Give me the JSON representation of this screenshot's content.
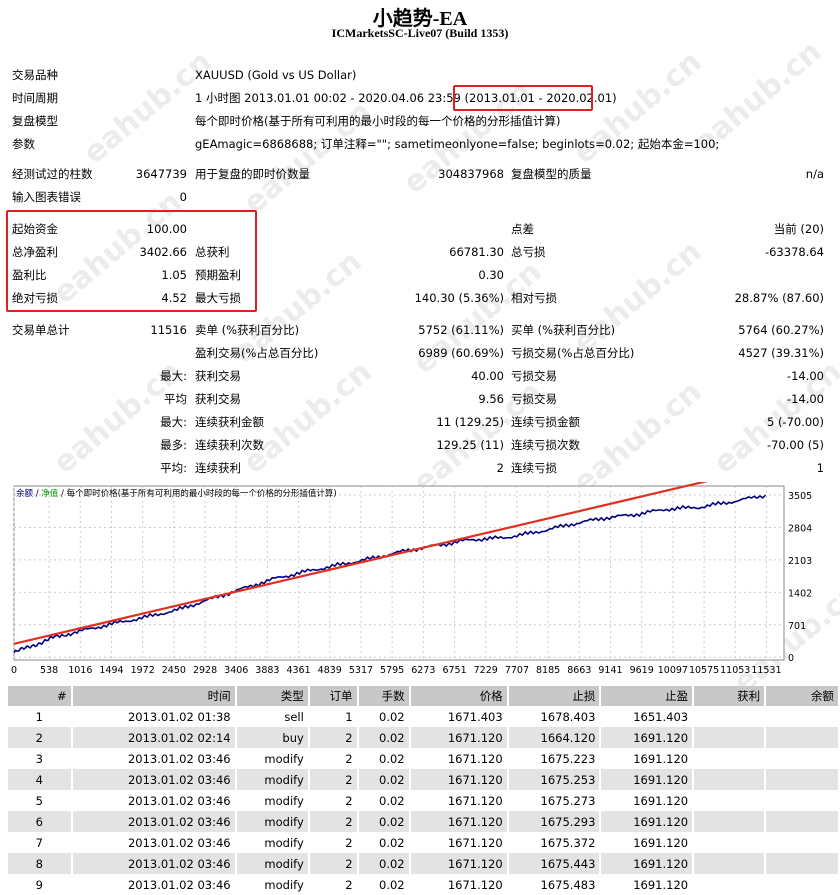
{
  "header": {
    "title": "小趋势-EA",
    "subtitle": "ICMarketsSC-Live07 (Build 1353)"
  },
  "info": {
    "symbol_label": "交易品种",
    "symbol_value": "XAUUSD (Gold vs US Dollar)",
    "period_label": "时间周期",
    "period_value": "1 小时图 2013.01.01 00:02 - 2020.04.06 23:59 (",
    "period_range": "2013.01.01 - 2020.02.01",
    "period_close": ")",
    "model_label": "复盘模型",
    "model_value": "每个即时价格(基于所有可利用的最小时段的每一个价格的分形插值计算)",
    "params_label": "参数",
    "params_value": "gEAmagic=6868688; 订单注释=\"\"; sametimeonlyone=false; beginlots=0.02; 起始本金=100;"
  },
  "test": {
    "bars_label": "经测试过的柱数",
    "bars_value": "3647739",
    "ticks_label": "用于复盘的即时价数量",
    "ticks_value": "304837968",
    "quality_label": "复盘模型的质量",
    "quality_value": "n/a",
    "errors_label": "输入图表错误",
    "errors_value": "0"
  },
  "stats": {
    "deposit_label": "起始资金",
    "deposit_value": "100.00",
    "spread_label": "点差",
    "spread_value": "当前 (20)",
    "net_label": "总净盈利",
    "net_value": "3402.66",
    "gross_profit_label": "总获利",
    "gross_profit_value": "66781.30",
    "gross_loss_label": "总亏损",
    "gross_loss_value": "-63378.64",
    "pf_label": "盈利比",
    "pf_value": "1.05",
    "payoff_label": "预期盈利",
    "payoff_value": "0.30",
    "abs_dd_label": "绝对亏损",
    "abs_dd_value": "4.52",
    "max_dd_label": "最大亏损",
    "max_dd_value": "140.30 (5.36%)",
    "rel_dd_label": "相对亏损",
    "rel_dd_value": "28.87% (87.60)",
    "trades_label": "交易单总计",
    "trades_value": "11516",
    "short_label": "卖单 (%获利百分比)",
    "short_value": "5752 (61.11%)",
    "long_label": "买单 (%获利百分比)",
    "long_value": "5764 (60.27%)",
    "profit_trades_label": "盈利交易(%占总百分比)",
    "profit_trades_value": "6989 (60.69%)",
    "loss_trades_label": "亏损交易(%占总百分比)",
    "loss_trades_value": "4527 (39.31%)",
    "max_label": "最大:",
    "largest_profit_label": "获利交易",
    "largest_profit_value": "40.00",
    "largest_loss_label": "亏损交易",
    "largest_loss_value": "-14.00",
    "avg_label": "平均",
    "avg_profit_label": "获利交易",
    "avg_profit_value": "9.56",
    "avg_loss_label": "亏损交易",
    "avg_loss_value": "-14.00",
    "max2_label": "最大:",
    "cons_win_amt_label": "连续获利金额",
    "cons_win_amt_value": "11 (129.25)",
    "cons_loss_amt_label": "连续亏损金额",
    "cons_loss_amt_value": "5 (-70.00)",
    "most_label": "最多:",
    "cons_win_cnt_label": "连续获利次数",
    "cons_win_cnt_value": "129.25 (11)",
    "cons_loss_cnt_label": "连续亏损次数",
    "cons_loss_cnt_value": "-70.00 (5)",
    "avg2_label": "平均:",
    "avg_cons_win_label": "连续获利",
    "avg_cons_win_value": "2",
    "avg_cons_loss_label": "连续亏损",
    "avg_cons_loss_value": "1"
  },
  "chart_data": {
    "type": "line",
    "legend": "余额 / 净值 / 每个即时价格(基于所有可利用的最小时段的每一个价格的分形插值计算)",
    "legend_balance": "余额",
    "legend_equity": "净值",
    "legend_rest": "每个即时价格(基于所有可利用的最小时段的每一个价格的分形插值计算)",
    "x_ticks": [
      "0",
      "538",
      "1016",
      "1494",
      "1972",
      "2450",
      "2928",
      "3406",
      "3883",
      "4361",
      "4839",
      "5317",
      "5795",
      "6273",
      "6751",
      "7229",
      "7707",
      "8185",
      "8663",
      "9141",
      "9619",
      "10097",
      "10575",
      "11053",
      "11531"
    ],
    "y_ticks": [
      "3505",
      "2804",
      "2103",
      "1402",
      "701",
      "0"
    ],
    "xlim": [
      0,
      11800
    ],
    "ylim": [
      -60,
      3700
    ],
    "series": [
      {
        "x": [
          0,
          300,
          600,
          1000,
          1500,
          2000,
          2500,
          3000,
          3500,
          4000,
          4500,
          5000,
          5500,
          6000,
          6500,
          7000,
          7500,
          8000,
          8500,
          9000,
          9500,
          10000,
          10500,
          11000,
          11516
        ],
        "values": [
          100,
          260,
          420,
          560,
          720,
          860,
          1020,
          1250,
          1480,
          1700,
          1860,
          2000,
          2140,
          2300,
          2420,
          2540,
          2580,
          2700,
          2860,
          3000,
          3080,
          3200,
          3240,
          3360,
          3502
        ]
      }
    ],
    "accent_color": "#e03020",
    "line_color": "#000080"
  },
  "trades_table": {
    "headers": [
      "#",
      "时间",
      "类型",
      "订单",
      "手数",
      "价格",
      "止损",
      "止盈",
      "获利",
      "余额"
    ],
    "rows": [
      [
        "1",
        "2013.01.02 01:38",
        "sell",
        "1",
        "0.02",
        "1671.403",
        "1678.403",
        "1651.403",
        "",
        ""
      ],
      [
        "2",
        "2013.01.02 02:14",
        "buy",
        "2",
        "0.02",
        "1671.120",
        "1664.120",
        "1691.120",
        "",
        ""
      ],
      [
        "3",
        "2013.01.02 03:46",
        "modify",
        "2",
        "0.02",
        "1671.120",
        "1675.223",
        "1691.120",
        "",
        ""
      ],
      [
        "4",
        "2013.01.02 03:46",
        "modify",
        "2",
        "0.02",
        "1671.120",
        "1675.253",
        "1691.120",
        "",
        ""
      ],
      [
        "5",
        "2013.01.02 03:46",
        "modify",
        "2",
        "0.02",
        "1671.120",
        "1675.273",
        "1691.120",
        "",
        ""
      ],
      [
        "6",
        "2013.01.02 03:46",
        "modify",
        "2",
        "0.02",
        "1671.120",
        "1675.293",
        "1691.120",
        "",
        ""
      ],
      [
        "7",
        "2013.01.02 03:46",
        "modify",
        "2",
        "0.02",
        "1671.120",
        "1675.372",
        "1691.120",
        "",
        ""
      ],
      [
        "8",
        "2013.01.02 03:46",
        "modify",
        "2",
        "0.02",
        "1671.120",
        "1675.443",
        "1691.120",
        "",
        ""
      ],
      [
        "9",
        "2013.01.02 03:46",
        "modify",
        "2",
        "0.02",
        "1671.120",
        "1675.483",
        "1691.120",
        "",
        ""
      ]
    ]
  },
  "watermark": "eahub.cn"
}
